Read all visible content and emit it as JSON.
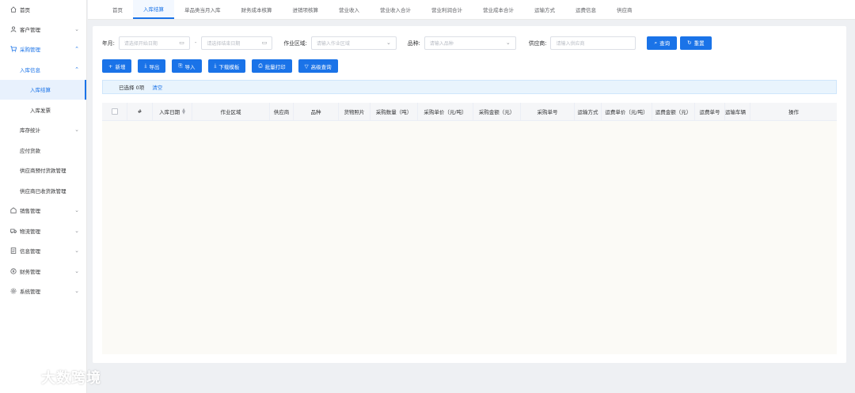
{
  "sidebar": {
    "items": [
      {
        "label": "首页",
        "icon": "home-icon",
        "expand": ""
      },
      {
        "label": "客户管理",
        "icon": "user-icon",
        "expand": "chevron-down"
      },
      {
        "label": "采购管理",
        "icon": "cart-icon",
        "expand": "chevron-up"
      },
      {
        "label": "入库信息",
        "icon": "",
        "expand": "chevron-up"
      },
      {
        "label": "入库结算",
        "icon": "",
        "expand": ""
      },
      {
        "label": "入库发票",
        "icon": "",
        "expand": ""
      },
      {
        "label": "库存统计",
        "icon": "",
        "expand": "chevron-down"
      },
      {
        "label": "应付货款",
        "icon": "",
        "expand": ""
      },
      {
        "label": "供应商预付货款管理",
        "icon": "",
        "expand": ""
      },
      {
        "label": "供应商已收货款管理",
        "icon": "",
        "expand": ""
      },
      {
        "label": "销售管理",
        "icon": "sales-icon",
        "expand": "chevron-down"
      },
      {
        "label": "物流管理",
        "icon": "truck-icon",
        "expand": "chevron-down"
      },
      {
        "label": "信息管理",
        "icon": "doc-icon",
        "expand": "chevron-down"
      },
      {
        "label": "财务管理",
        "icon": "coin-icon",
        "expand": "chevron-down"
      },
      {
        "label": "系统管理",
        "icon": "gear-icon",
        "expand": "chevron-down"
      }
    ]
  },
  "tabs": [
    "首页",
    "入库结算",
    "单品类当月入库",
    "财务成本核算",
    "进销项核算",
    "营业收入",
    "营业收入合计",
    "营业利润合计",
    "营业成本合计",
    "运输方式",
    "运费信息",
    "供应商"
  ],
  "filters": {
    "month_label": "年月:",
    "start_placeholder": "请选择开始日期",
    "range_sep": "-",
    "end_placeholder": "请选择结束日期",
    "area_label": "作业区域:",
    "area_placeholder": "请输入作业区域",
    "variety_label": "品种:",
    "variety_placeholder": "请输入品种",
    "supplier_label": "供应商:",
    "supplier_placeholder": "请输入供应商",
    "search_btn": "查询",
    "reset_btn": "重置"
  },
  "toolbar": {
    "add": "新增",
    "export": "导出",
    "import": "导入",
    "download_template": "下载模板",
    "batch_print": "批量打印",
    "advanced_search": "高级查询"
  },
  "selection": {
    "selected_text": "已选择 0项",
    "clear": "清空"
  },
  "table": {
    "columns": [
      "#",
      "入库日期",
      "作业区域",
      "供应商",
      "品种",
      "货物照片",
      "采购数量（吨）",
      "采购单价（元/吨）",
      "采购金额（元）",
      "采购单号",
      "运输方式",
      "运费单价（元/吨）",
      "运费金额（元）",
      "运费单号",
      "运输车辆",
      "操作"
    ]
  },
  "watermark": "大数跨境",
  "colors": {
    "accent": "#1a73e8",
    "selection_bg": "#e9f4fd",
    "header_bg": "#f5f6f8"
  }
}
